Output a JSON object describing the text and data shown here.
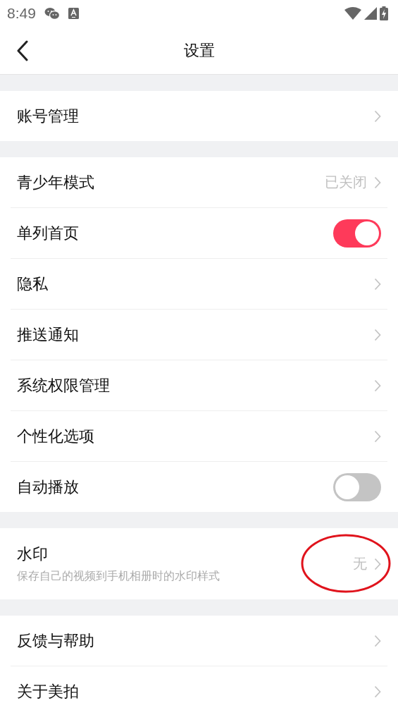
{
  "status_bar": {
    "time": "8:49"
  },
  "header": {
    "title": "设置"
  },
  "sections": [
    [
      {
        "kind": "link",
        "label": "账号管理"
      }
    ],
    [
      {
        "kind": "link",
        "label": "青少年模式",
        "value": "已关闭"
      },
      {
        "kind": "toggle",
        "label": "单列首页",
        "on": true
      },
      {
        "kind": "link",
        "label": "隐私"
      },
      {
        "kind": "link",
        "label": "推送通知"
      },
      {
        "kind": "link",
        "label": "系统权限管理"
      },
      {
        "kind": "link",
        "label": "个性化选项"
      },
      {
        "kind": "toggle",
        "label": "自动播放",
        "on": false
      }
    ],
    [
      {
        "kind": "link",
        "label": "水印",
        "subtitle": "保存自己的视频到手机相册时的水印样式",
        "value": "无",
        "circled": true
      }
    ],
    [
      {
        "kind": "link",
        "label": "反馈与帮助"
      },
      {
        "kind": "link",
        "label": "关于美拍"
      }
    ]
  ]
}
